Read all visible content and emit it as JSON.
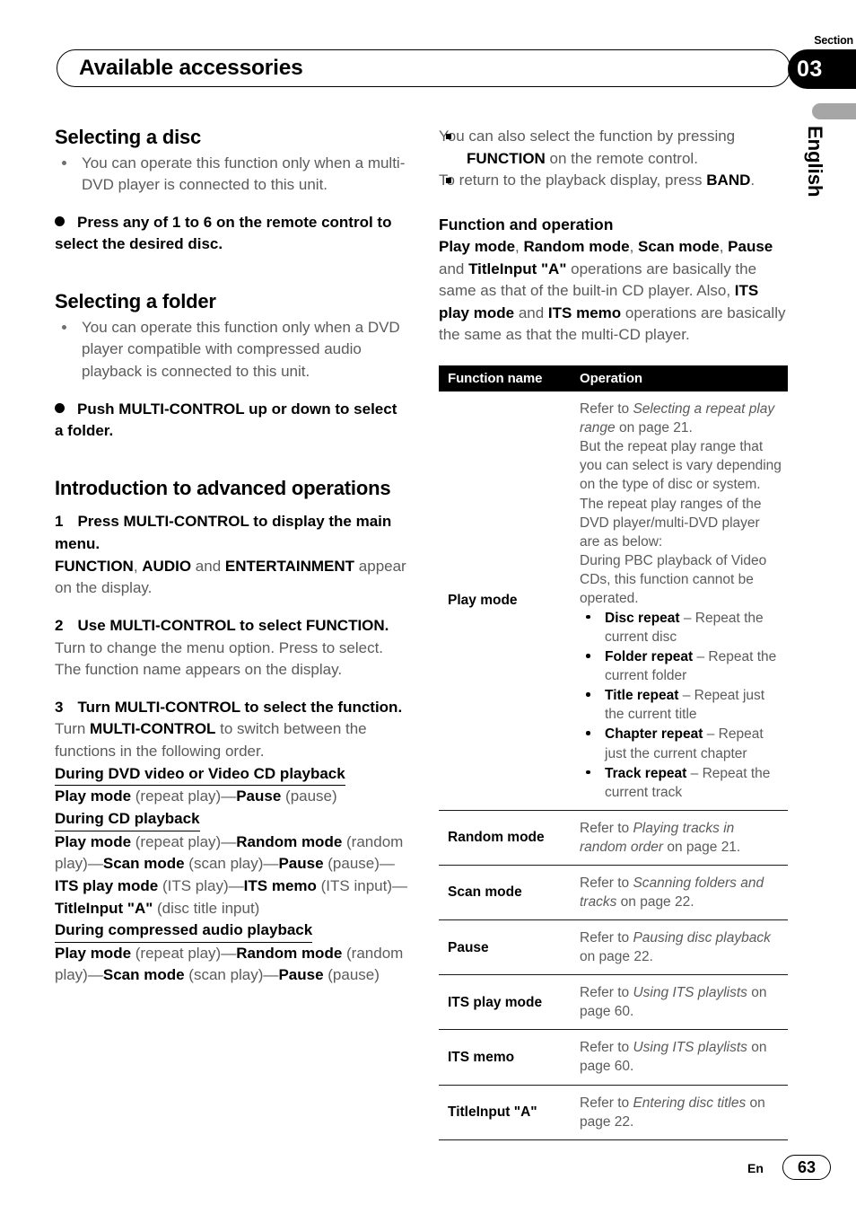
{
  "header": {
    "section_label": "Section",
    "section_number": "03",
    "title": "Available accessories",
    "language_tab": "English"
  },
  "footer": {
    "lang_code": "En",
    "page_number": "63"
  },
  "left_column": {
    "selecting_disc": {
      "heading": "Selecting a disc",
      "note": "You can operate this function only when a multi-DVD player is connected to this unit.",
      "procedure": "Press any of 1 to 6 on the remote control to select the desired disc."
    },
    "selecting_folder": {
      "heading": "Selecting a folder",
      "note": "You can operate this function only when a DVD player compatible with compressed audio playback is connected to this unit.",
      "procedure": "Push MULTI-CONTROL up or down to select a folder."
    },
    "intro_advanced": {
      "heading": "Introduction to advanced operations",
      "step1": {
        "num": "1",
        "title": "Press MULTI-CONTROL to display the main menu.",
        "body_bold_1": "FUNCTION",
        "body_plain_1": ", ",
        "body_bold_2": "AUDIO",
        "body_plain_2": " and ",
        "body_bold_3": "ENTERTAINMENT",
        "body_plain_3": " appear on the display."
      },
      "step2": {
        "num": "2",
        "title": "Use MULTI-CONTROL to select FUNCTION.",
        "body_line1": "Turn to change the menu option. Press to select.",
        "body_line2": "The function name appears on the display."
      },
      "step3": {
        "num": "3",
        "title": "Turn MULTI-CONTROL to select the function.",
        "body_prefix": "Turn ",
        "body_bold": "MULTI-CONTROL",
        "body_suffix": " to switch between the functions in the following order."
      },
      "orders": [
        {
          "heading": "During DVD video or Video CD playback",
          "sequence_html": "<b>Play mode</b> (repeat play)—<b>Pause</b> (pause)"
        },
        {
          "heading": "During CD playback",
          "sequence_html": "<b>Play mode</b> (repeat play)—<b>Random mode</b> (random play)—<b>Scan mode</b> (scan play)—<b>Pause</b> (pause)—<b>ITS play mode</b> (ITS play)—<b>ITS memo</b> (ITS input)—<b>TitleInput \"A\"</b> (disc title input)"
        },
        {
          "heading": "During compressed audio playback",
          "sequence_html": "<b>Play mode</b> (repeat play)—<b>Random mode</b> (random play)—<b>Scan mode</b> (scan play)—<b>Pause</b> (pause)"
        }
      ]
    }
  },
  "right_column": {
    "notes": [
      {
        "prefix": "You can also select the function by pressing ",
        "bold": "FUNCTION",
        "suffix": " on the remote control."
      },
      {
        "prefix": "To return to the playback display, press ",
        "bold": "BAND",
        "suffix": "."
      }
    ],
    "function_operation": {
      "heading": "Function and operation",
      "paragraph_html": "<b>Play mode</b>, <b>Random mode</b>, <b>Scan mode</b>, <b>Pause</b> and <b>TitleInput \"A\"</b> operations are basically the same as that of the built-in CD player. Also, <b>ITS play mode</b> and <b>ITS memo</b> operations are basically the same as that the multi-CD player."
    },
    "table": {
      "headers": [
        "Function name",
        "Operation"
      ],
      "play_mode": {
        "name": "Play mode",
        "intro_html": "Refer to <i>Selecting a repeat play range</i> on page 21.<br>But the repeat play range that you can select is vary depending on the type of disc or system. The repeat play ranges of the DVD player/multi-DVD player are as below:<br>During PBC playback of Video CDs, this function cannot be operated.",
        "items": [
          {
            "term": "Disc repeat",
            "desc": " – Repeat the current disc"
          },
          {
            "term": "Folder repeat",
            "desc": " – Repeat the current folder"
          },
          {
            "term": "Title repeat",
            "desc": " – Repeat just the current title"
          },
          {
            "term": "Chapter repeat",
            "desc": " – Repeat just the current chapter"
          },
          {
            "term": "Track repeat",
            "desc": " – Repeat the current track"
          }
        ]
      },
      "rows": [
        {
          "name": "Random mode",
          "operation_html": "Refer to <i>Playing tracks in random order</i> on page 21."
        },
        {
          "name": "Scan mode",
          "operation_html": "Refer to <i>Scanning folders and tracks</i> on page 22."
        },
        {
          "name": "Pause",
          "operation_html": "Refer to <i>Pausing disc playback</i> on page 22."
        },
        {
          "name": "ITS play mode",
          "operation_html": "Refer to <i>Using ITS playlists</i> on page 60."
        },
        {
          "name": "ITS memo",
          "operation_html": "Refer to <i>Using ITS playlists</i> on page 60."
        },
        {
          "name": "TitleInput \"A\"",
          "operation_html": "Refer to <i>Entering disc titles</i> on page 22."
        }
      ]
    }
  }
}
